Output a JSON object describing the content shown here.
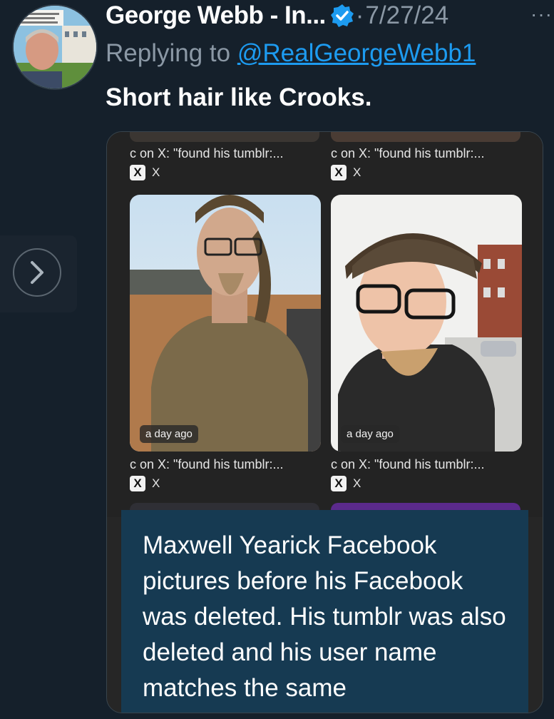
{
  "tweet": {
    "author": "George Webb - In...",
    "date": "7/27/24",
    "separator": "·",
    "more": "···",
    "reply_prefix": "Replying to",
    "reply_handle": "@RealGeorgeWebb1",
    "text": "Short hair like Crooks."
  },
  "media": {
    "captions": [
      "c on X: \"found his tumblr:...",
      "c on X: \"found his tumblr:...",
      "c on X: \"found his tumblr:...",
      "c on X: \"found his tumblr:..."
    ],
    "source_logo": "X",
    "source_label": "X",
    "photo_badge": "a day ago",
    "text_card": "Maxwell Yearick Facebook pictures before his Facebook was deleted. His tumblr was also deleted and his user name matches the same"
  },
  "nav": {
    "arrow_icon": "chevron-right-icon"
  },
  "colors": {
    "background": "#15202b",
    "accent": "#1d9bf0",
    "text_card": "#163a52"
  }
}
